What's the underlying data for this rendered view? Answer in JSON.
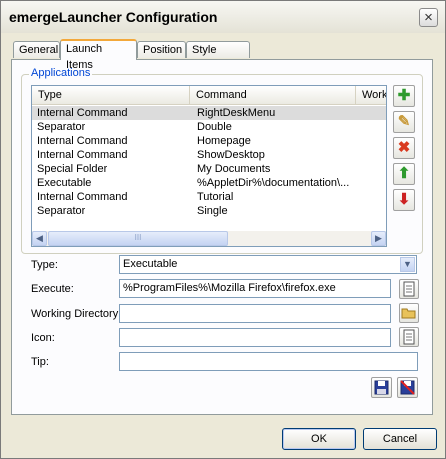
{
  "window": {
    "title": "emergeLauncher Configuration",
    "close_glyph": "×"
  },
  "tabs": [
    {
      "label": "General"
    },
    {
      "label": "Launch Items",
      "active": true
    },
    {
      "label": "Position"
    },
    {
      "label": "Style Editor"
    }
  ],
  "applications": {
    "group_label": "Applications",
    "columns": [
      "Type",
      "Command",
      "Worki"
    ],
    "rows": [
      {
        "type": "Internal Command",
        "command": "RightDeskMenu",
        "selected": true
      },
      {
        "type": "Separator",
        "command": "Double"
      },
      {
        "type": "Internal Command",
        "command": "Homepage"
      },
      {
        "type": "Internal Command",
        "command": "ShowDesktop"
      },
      {
        "type": "Special Folder",
        "command": "My Documents"
      },
      {
        "type": "Executable",
        "command": "%AppletDir%\\documentation\\..."
      },
      {
        "type": "Internal Command",
        "command": "Tutorial"
      },
      {
        "type": "Separator",
        "command": "Single"
      }
    ],
    "scrollbar": {
      "left_arrow": "◀",
      "right_arrow": "▶",
      "grip": "III"
    }
  },
  "side_buttons": [
    {
      "name": "add-item-button",
      "glyph": "✚",
      "color": "#2e9a2e"
    },
    {
      "name": "edit-item-button",
      "glyph": "✎",
      "color": "#c89a3a"
    },
    {
      "name": "delete-item-button",
      "glyph": "✖",
      "color": "#d93a1f"
    },
    {
      "name": "move-up-button",
      "glyph": "⬆",
      "color": "#2e9a2e"
    },
    {
      "name": "move-down-button",
      "glyph": "⬇",
      "color": "#cc2222"
    }
  ],
  "form": {
    "type_label": "Type:",
    "type_value": "Executable",
    "execute_label": "Execute:",
    "execute_value": "%ProgramFiles%\\Mozilla Firefox\\firefox.exe",
    "working_dir_label": "Working Directory:",
    "working_dir_value": "",
    "icon_label": "Icon:",
    "icon_value": "",
    "tip_label": "Tip:",
    "tip_value": ""
  },
  "buttons": {
    "ok": "OK",
    "cancel": "Cancel"
  },
  "colors": {
    "accent": "#0046d5",
    "tab_highlight": "#f3a83a"
  }
}
